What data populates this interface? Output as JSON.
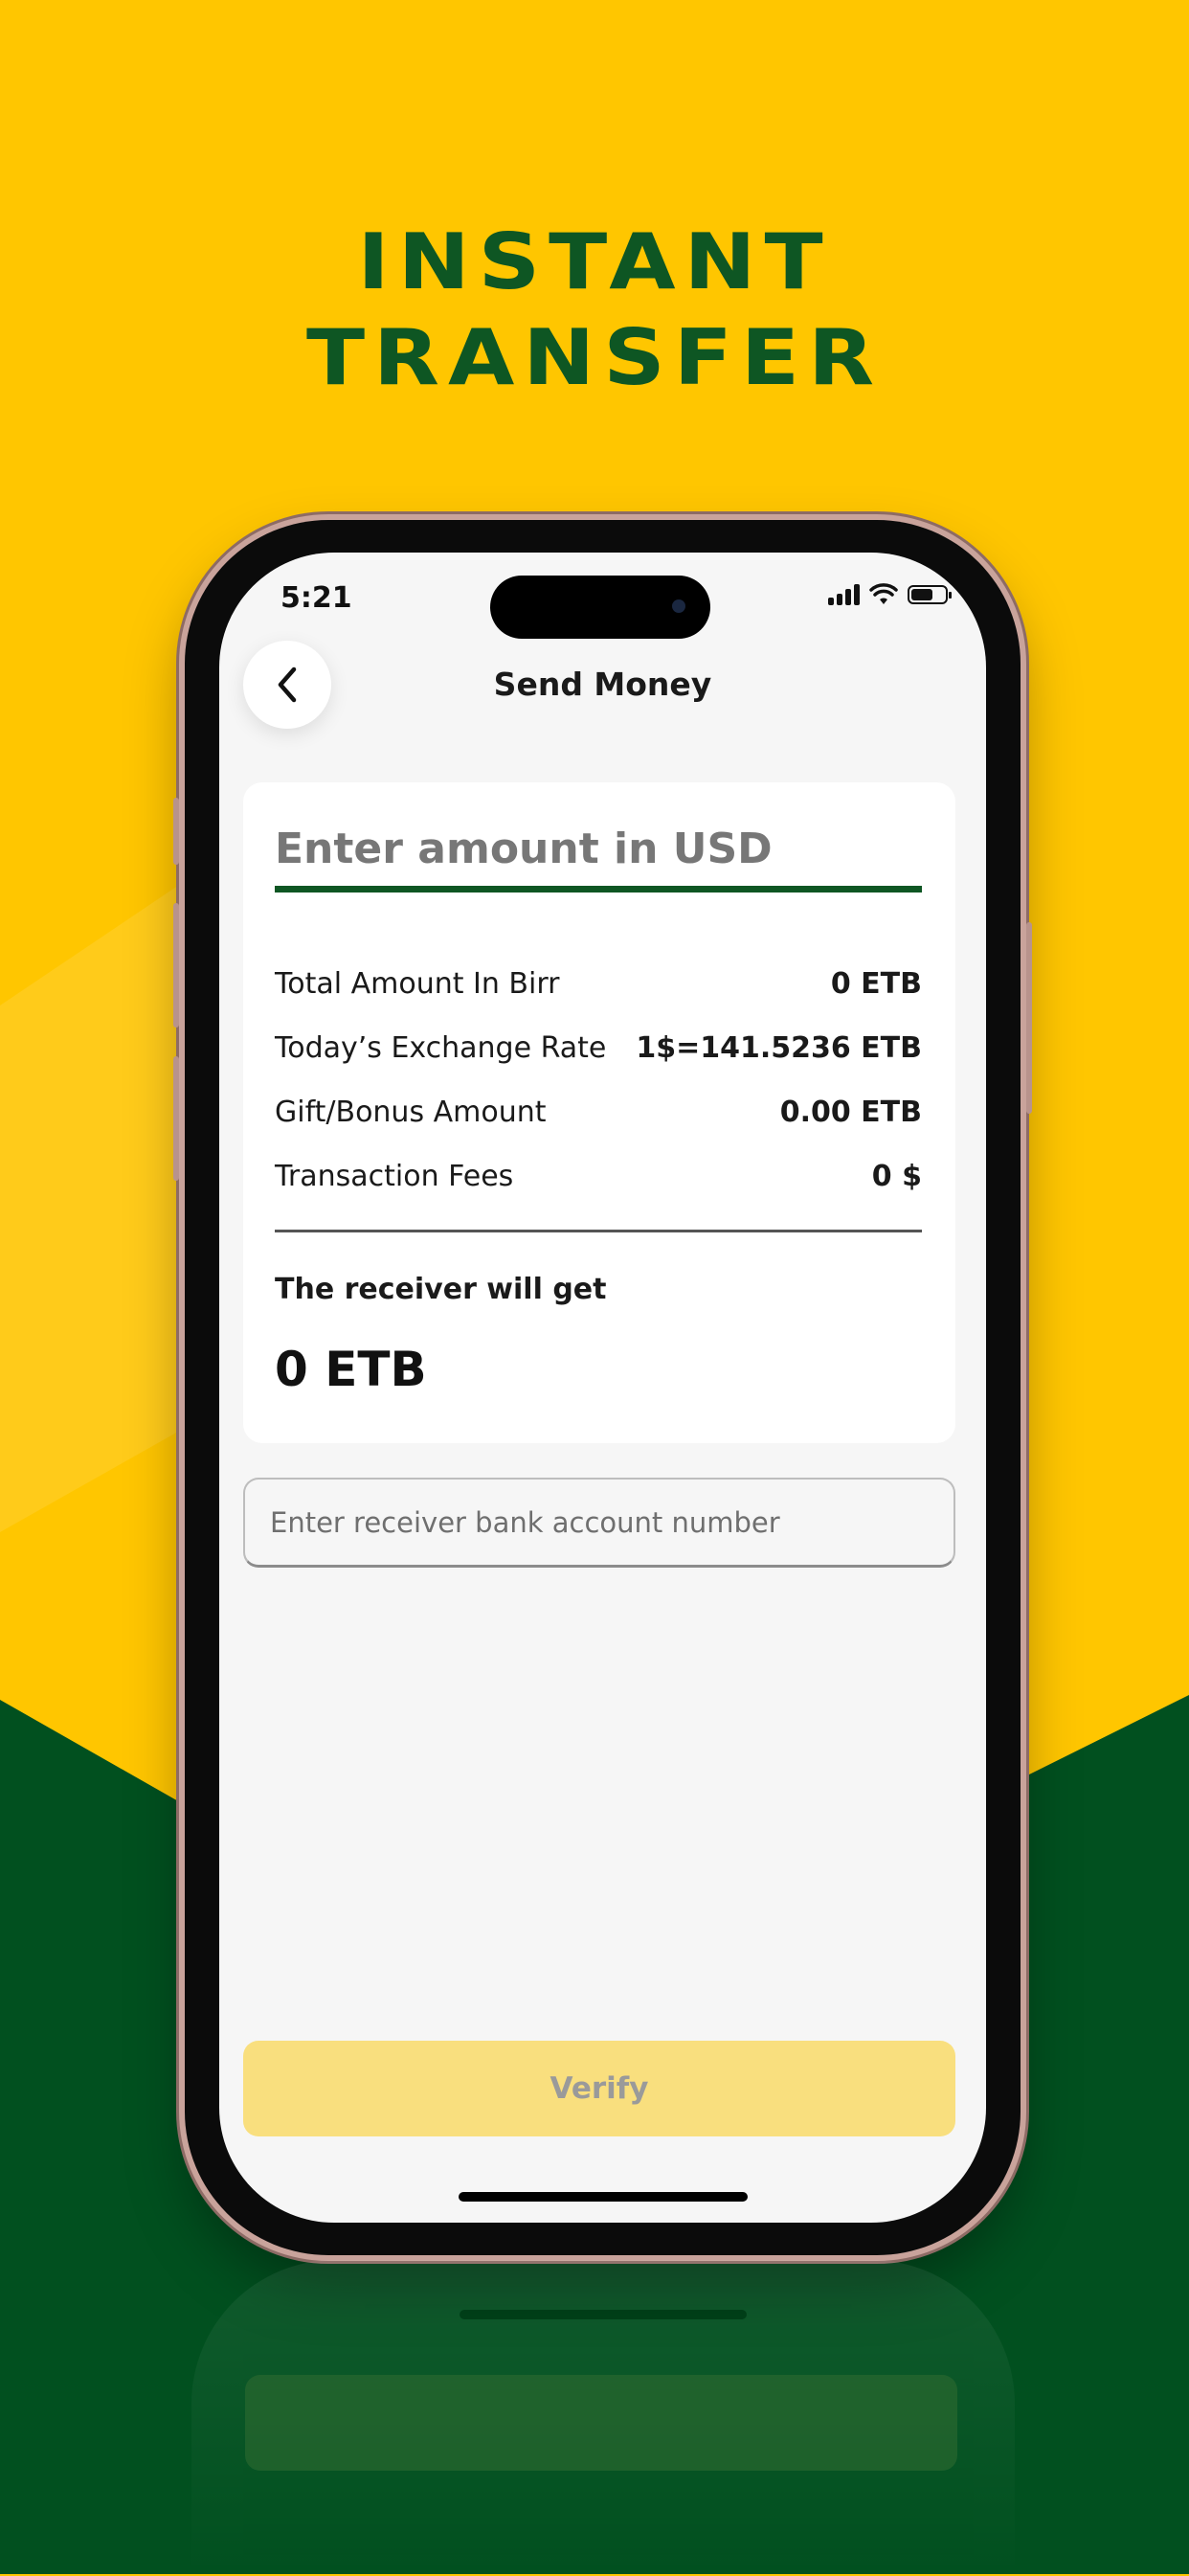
{
  "headline": {
    "line1": "INSTANT",
    "line2": "TRANSFER"
  },
  "status_bar": {
    "time": "5:21",
    "icons": [
      "signal-icon",
      "wifi-icon",
      "battery-icon"
    ]
  },
  "header": {
    "back_icon": "chevron-left-icon",
    "title": "Send Money"
  },
  "amount_card": {
    "amount_placeholder": "Enter amount in USD",
    "rows": [
      {
        "label": "Total Amount In Birr",
        "value": "0 ETB"
      },
      {
        "label": "Today’s Exchange Rate",
        "value": "1$=141.5236 ETB"
      },
      {
        "label": "Gift/Bonus Amount",
        "value": "0.00 ETB"
      },
      {
        "label": "Transaction Fees",
        "value": "0 $"
      }
    ],
    "receiver_label": "The receiver will get",
    "receiver_value": "0 ETB"
  },
  "account_field": {
    "placeholder": "Enter receiver bank account number",
    "value": ""
  },
  "verify_button": {
    "label": "Verify",
    "enabled": false
  },
  "colors": {
    "background_yellow": "#FFC600",
    "brand_green": "#0E5623",
    "button_disabled": "#F9DF7E",
    "screen_bg": "#F6F6F6"
  }
}
